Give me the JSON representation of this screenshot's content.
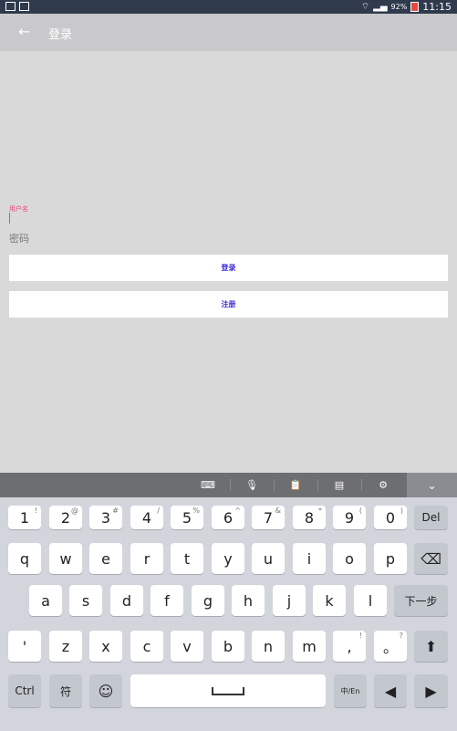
{
  "status_bar": {
    "battery_pct": "92%",
    "time": "11:15"
  },
  "app_bar": {
    "back_icon": "←",
    "title": "登录"
  },
  "form": {
    "username_label": "用户名",
    "password_placeholder": "密码",
    "login_button": "登录",
    "register_button": "注册"
  },
  "keyboard_toolbar": {
    "icons": [
      "keyboard-icon",
      "mic-icon",
      "clipboard-icon",
      "keyboard-layout-icon",
      "gear-icon",
      "chevron-down-icon"
    ]
  },
  "keyboard": {
    "row1": [
      {
        "main": "1",
        "sup": "!"
      },
      {
        "main": "2",
        "sup": "@"
      },
      {
        "main": "3",
        "sup": "#"
      },
      {
        "main": "4",
        "sup": "/"
      },
      {
        "main": "5",
        "sup": "%"
      },
      {
        "main": "6",
        "sup": "^"
      },
      {
        "main": "7",
        "sup": "&"
      },
      {
        "main": "8",
        "sup": "*"
      },
      {
        "main": "9",
        "sup": "("
      },
      {
        "main": "0",
        "sup": ")"
      },
      {
        "main": "Del",
        "sup": ""
      }
    ],
    "row2": [
      "q",
      "w",
      "e",
      "r",
      "t",
      "y",
      "u",
      "i",
      "o",
      "p",
      "⌫"
    ],
    "row3": [
      "a",
      "s",
      "d",
      "f",
      "g",
      "h",
      "j",
      "k",
      "l",
      "下一步"
    ],
    "row4": [
      "'",
      "z",
      "x",
      "c",
      "v",
      "b",
      "n",
      "m",
      ",",
      "。",
      "⬆"
    ],
    "row4_sups": {
      "comma": "!",
      "period": "?"
    },
    "row5": [
      "Ctrl",
      "符",
      "☺",
      "",
      "中/En",
      "◀",
      "▶"
    ]
  }
}
